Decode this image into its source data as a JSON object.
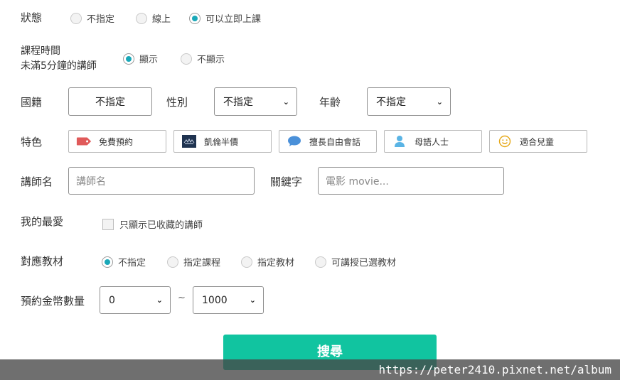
{
  "status": {
    "label": "狀態",
    "options": [
      "不指定",
      "線上",
      "可以立即上課"
    ],
    "selected": 2
  },
  "course_time": {
    "label_line1": "課程時間",
    "label_line2": "未滿5分鐘的講師",
    "options": [
      "顯示",
      "不顯示"
    ],
    "selected": 0
  },
  "nationality": {
    "label": "國籍",
    "value": "不指定"
  },
  "gender": {
    "label": "性別",
    "value": "不指定"
  },
  "age": {
    "label": "年齡",
    "value": "不指定"
  },
  "features": {
    "label": "特色",
    "chips": [
      {
        "label": "免費預約",
        "icon": "tag-icon"
      },
      {
        "label": "凱倫半價",
        "icon": "karen-logo-icon"
      },
      {
        "label": "擅長自由會話",
        "icon": "chat-bubble-icon"
      },
      {
        "label": "母語人士",
        "icon": "person-icon"
      },
      {
        "label": "適合兒童",
        "icon": "smiley-icon"
      }
    ],
    "colors": {
      "tag": "#e05a5a",
      "karen": "#1f3350",
      "chat": "#4a90d9",
      "person": "#5ab4e5",
      "smiley": "#e6a817"
    }
  },
  "tutor_name": {
    "label": "講師名",
    "placeholder": "講師名"
  },
  "keyword": {
    "label": "關鍵字",
    "placeholder": "電影 movie..."
  },
  "favorites": {
    "label": "我的最愛",
    "checkbox_label": "只顯示已收藏的講師",
    "checked": false
  },
  "materials": {
    "label": "對應教材",
    "options": [
      "不指定",
      "指定課程",
      "指定教材",
      "可講授已選教材"
    ],
    "selected": 0
  },
  "coins": {
    "label": "預約金幣數量",
    "min": "0",
    "tilde": "~",
    "max": "1000"
  },
  "search_button": {
    "label": "搜尋",
    "color": "#11c4a0"
  },
  "watermark": "https://peter2410.pixnet.net/album",
  "accent_color": "#1aa8b8"
}
